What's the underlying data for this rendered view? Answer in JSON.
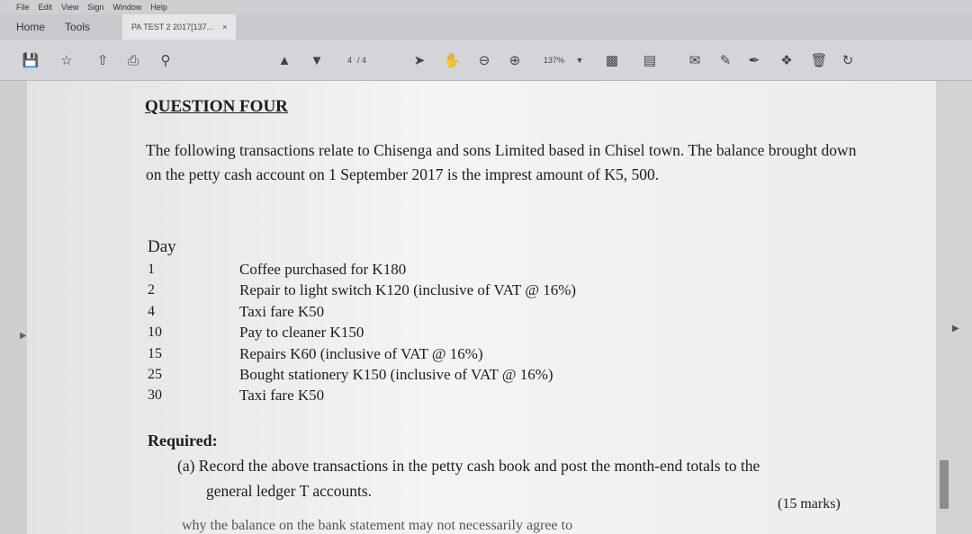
{
  "menu": [
    "File",
    "Edit",
    "View",
    "Sign",
    "Window",
    "Help"
  ],
  "tabs": {
    "home": "Home",
    "tools": "Tools",
    "document": "PA TEST 2 2017[137...",
    "close": "×"
  },
  "toolbar": {
    "page_current": "4",
    "page_total": "/ 4",
    "zoom": "137%"
  },
  "document": {
    "heading": "QUESTION FOUR",
    "paragraph": "The following transactions relate to Chisenga and sons Limited based in Chisel town. The balance brought down on the petty cash account on 1 September 2017 is the imprest amount of K5, 500.",
    "day_header": "Day",
    "transactions": [
      {
        "day": "1",
        "text": "Coffee purchased for K180"
      },
      {
        "day": "2",
        "text": "Repair to light switch K120 (inclusive of VAT @ 16%)"
      },
      {
        "day": "4",
        "text": "Taxi fare K50"
      },
      {
        "day": "10",
        "text": "Pay to cleaner K150"
      },
      {
        "day": "15",
        "text": "Repairs K60 (inclusive of VAT @ 16%)"
      },
      {
        "day": "25",
        "text": "Bought stationery K150 (inclusive of VAT @ 16%)"
      },
      {
        "day": "30",
        "text": "Taxi fare K50"
      }
    ],
    "required_label": "Required:",
    "required_a_line1": "(a) Record the above transactions in the petty cash book and post the month-end totals to the",
    "required_a_line2": "general ledger T accounts.",
    "marks": "(15 marks)",
    "cut_line": "why the balance on the bank statement may not necessarily agree to"
  }
}
